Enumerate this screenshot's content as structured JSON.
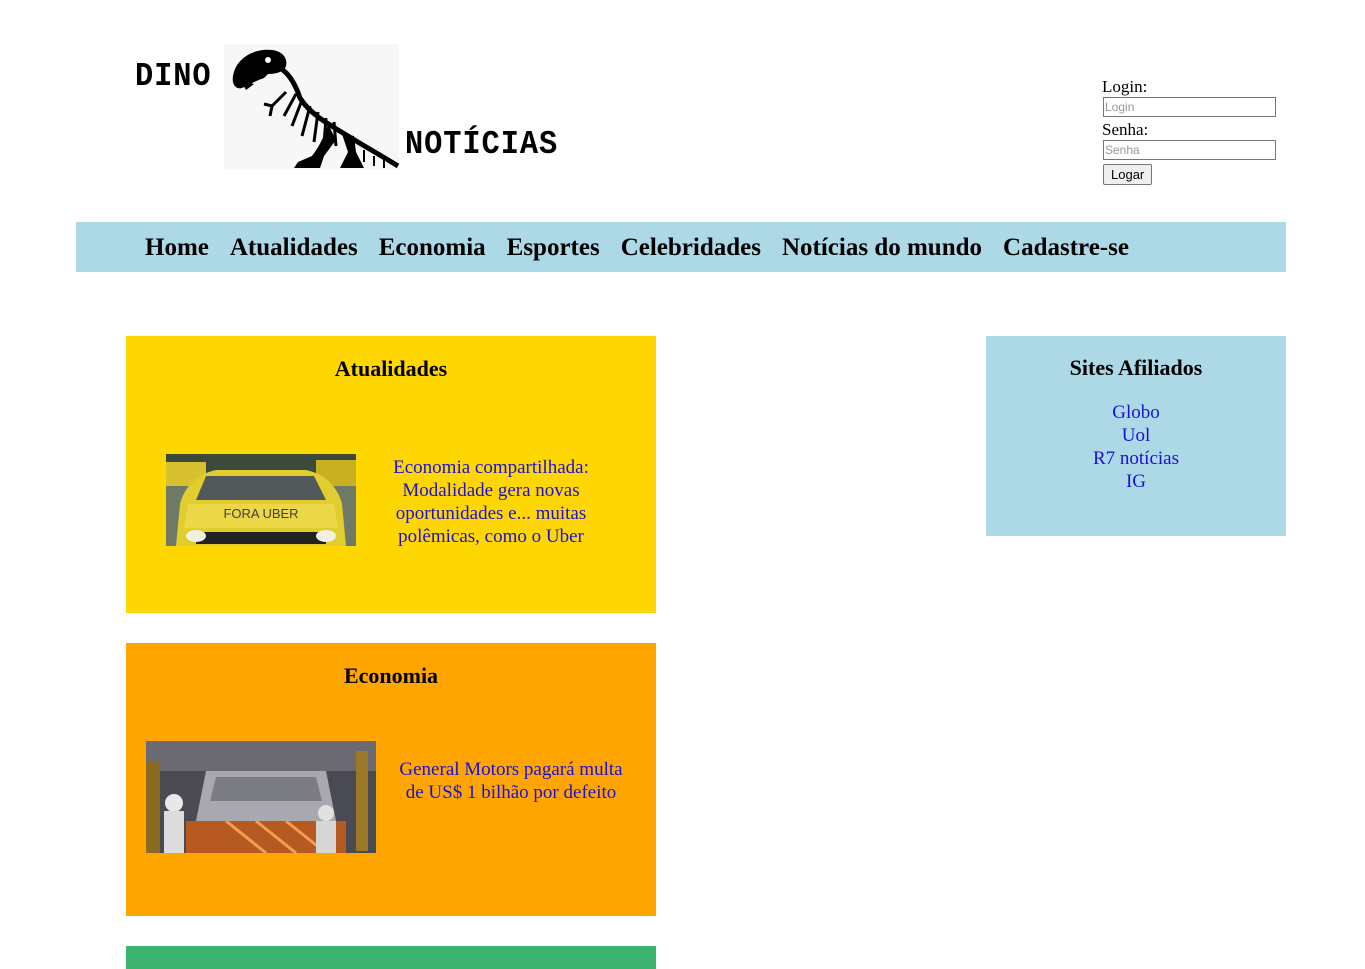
{
  "header": {
    "logo": {
      "word_top": "DINO",
      "word_bottom": "NOTÍCIAS"
    }
  },
  "login": {
    "login_label": "Login:",
    "login_placeholder": "Login",
    "password_label": "Senha:",
    "password_placeholder": "Senha",
    "submit_label": "Logar"
  },
  "nav": {
    "items": [
      "Home",
      "Atualidades",
      "Economia",
      "Esportes",
      "Celebridades",
      "Notícias do mundo",
      "Cadastre-se"
    ]
  },
  "sections": [
    {
      "title": "Atualidades",
      "color": "#ffd700",
      "headline": "Economia compartilhada: Modalidade gera novas oportunidades e... muitas polêmicas, como o Uber"
    },
    {
      "title": "Economia",
      "color": "#ffa500",
      "headline": "General Motors pagará multa de US$ 1 bilhão por defeito"
    },
    {
      "title": "",
      "color": "#3cb371"
    }
  ],
  "sidebar": {
    "title": "Sites Afiliados",
    "color": "#add8e6",
    "links": [
      "Globo",
      "Uol",
      "R7 notícias",
      "IG"
    ]
  },
  "colors": {
    "nav_background": "#add8e6",
    "link": "#1a10d8"
  }
}
